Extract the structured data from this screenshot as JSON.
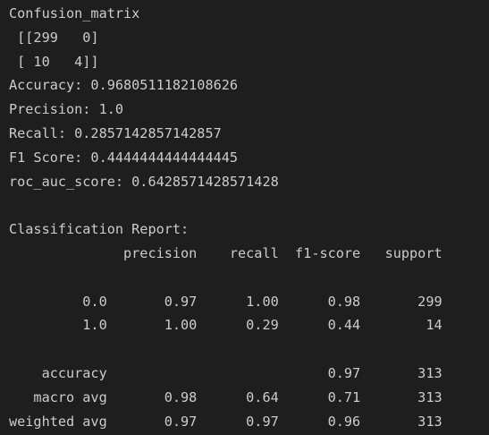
{
  "output": {
    "lines": [
      "Confusion_matrix",
      " [[299   0]",
      " [ 10   4]]",
      "Accuracy: 0.9680511182108626",
      "Precision: 1.0",
      "Recall: 0.2857142857142857",
      "F1 Score: 0.4444444444444445",
      "roc_auc_score: 0.6428571428571428",
      "",
      "Classification Report:",
      "              precision    recall  f1-score   support",
      "",
      "         0.0       0.97      1.00      0.98       299",
      "         1.0       1.00      0.29      0.44        14",
      "",
      "    accuracy                           0.97       313",
      "   macro avg       0.98      0.64      0.71       313",
      "weighted avg       0.97      0.97      0.96       313"
    ]
  },
  "colors": {
    "background": "#1e1e1e",
    "text": "#cccccc"
  }
}
